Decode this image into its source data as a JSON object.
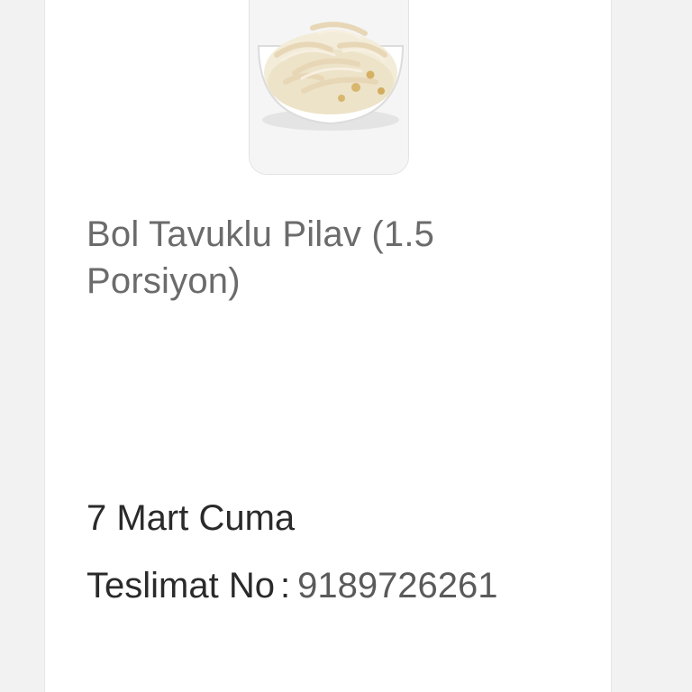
{
  "product": {
    "name": "Bol Tavuklu Pilav (1.5 Porsiyon)",
    "image_icon": "chicken-rice-bowl-icon"
  },
  "order": {
    "date": "7 Mart Cuma",
    "delivery_label": "Teslimat No",
    "separator": ":",
    "delivery_number": "9189726261"
  },
  "colors": {
    "background": "#f2f2f2",
    "card": "#ffffff",
    "product_text": "#6b6b6b",
    "primary_text": "#2a2a2a"
  }
}
